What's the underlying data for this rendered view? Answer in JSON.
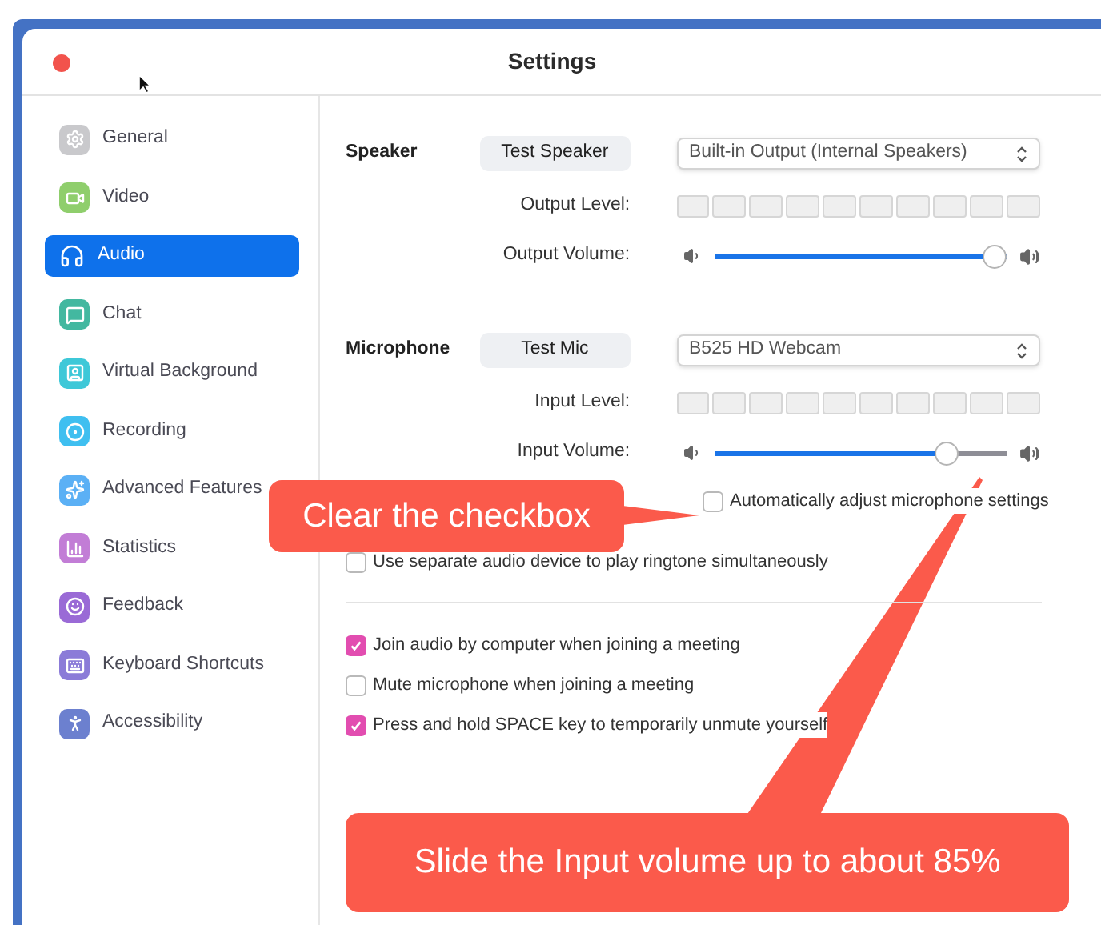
{
  "window": {
    "title": "Settings"
  },
  "sidebar": {
    "items": [
      {
        "label": "General",
        "selected": false
      },
      {
        "label": "Video",
        "selected": false
      },
      {
        "label": "Audio",
        "selected": true
      },
      {
        "label": "Chat",
        "selected": false
      },
      {
        "label": "Virtual Background",
        "selected": false
      },
      {
        "label": "Recording",
        "selected": false
      },
      {
        "label": "Advanced Features",
        "selected": false
      },
      {
        "label": "Statistics",
        "selected": false
      },
      {
        "label": "Feedback",
        "selected": false
      },
      {
        "label": "Keyboard Shortcuts",
        "selected": false
      },
      {
        "label": "Accessibility",
        "selected": false
      }
    ]
  },
  "speaker": {
    "label": "Speaker",
    "test_button": "Test Speaker",
    "device": "Built-in Output (Internal Speakers)",
    "level_label": "Output Level:",
    "volume_label": "Output Volume:",
    "volume": {
      "level": 1
    }
  },
  "microphone": {
    "label": "Microphone",
    "test_button": "Test Mic",
    "device": "B525 HD Webcam",
    "level_label": "Input Level:",
    "volume_label": "Input Volume:",
    "volume": {
      "level": 0.82
    },
    "auto_adjust": {
      "label": "Automatically adjust microphone settings",
      "checked": false
    }
  },
  "ringtone_option": {
    "label": "Use separate audio device to play ringtone simultaneously",
    "checked": false
  },
  "meeting_options": [
    {
      "label": "Join audio by computer when joining a meeting",
      "checked": true
    },
    {
      "label": "Mute microphone when joining a meeting",
      "checked": false
    },
    {
      "label": "Press and hold SPACE key to temporarily unmute yourself",
      "checked": true
    }
  ],
  "callouts": [
    {
      "text": "Clear the checkbox"
    },
    {
      "text": "Slide the Input volume up to about 85%"
    }
  ]
}
